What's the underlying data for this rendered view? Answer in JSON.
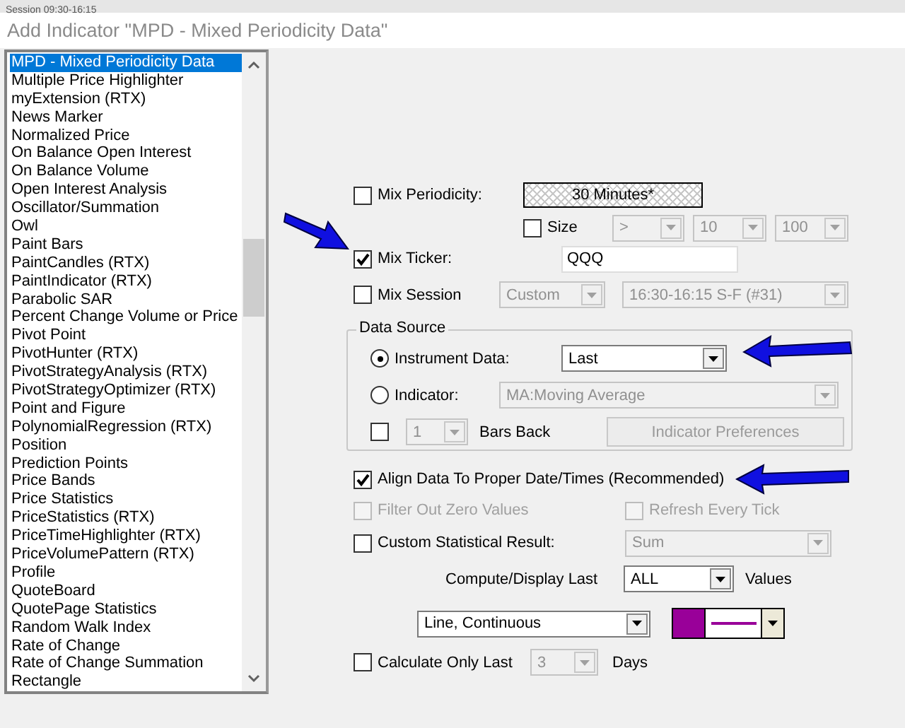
{
  "background_text": "Session 09:30-16:15",
  "window": {
    "title": "Add Indicator \"MPD - Mixed Periodicity Data\""
  },
  "indicator_list": [
    {
      "label": "MPD - Mixed Periodicity Data",
      "selected": true
    },
    {
      "label": "Multiple Price Highlighter",
      "selected": false
    },
    {
      "label": "myExtension (RTX)",
      "selected": false
    },
    {
      "label": "News Marker",
      "selected": false
    },
    {
      "label": "Normalized Price",
      "selected": false
    },
    {
      "label": "On Balance Open Interest",
      "selected": false
    },
    {
      "label": "On Balance Volume",
      "selected": false
    },
    {
      "label": "Open Interest Analysis",
      "selected": false
    },
    {
      "label": "Oscillator/Summation",
      "selected": false
    },
    {
      "label": "Owl",
      "selected": false
    },
    {
      "label": "Paint Bars",
      "selected": false
    },
    {
      "label": "PaintCandles (RTX)",
      "selected": false
    },
    {
      "label": "PaintIndicator (RTX)",
      "selected": false
    },
    {
      "label": "Parabolic SAR",
      "selected": false
    },
    {
      "label": "Percent Change Volume or Price",
      "selected": false
    },
    {
      "label": "Pivot Point",
      "selected": false
    },
    {
      "label": "PivotHunter (RTX)",
      "selected": false
    },
    {
      "label": "PivotStrategyAnalysis (RTX)",
      "selected": false
    },
    {
      "label": "PivotStrategyOptimizer (RTX)",
      "selected": false
    },
    {
      "label": "Point and Figure",
      "selected": false
    },
    {
      "label": "PolynomialRegression (RTX)",
      "selected": false
    },
    {
      "label": "Position",
      "selected": false
    },
    {
      "label": "Prediction Points",
      "selected": false
    },
    {
      "label": "Price Bands",
      "selected": false
    },
    {
      "label": "Price Statistics",
      "selected": false
    },
    {
      "label": "PriceStatistics (RTX)",
      "selected": false
    },
    {
      "label": "PriceTimeHighlighter (RTX)",
      "selected": false
    },
    {
      "label": "PriceVolumePattern (RTX)",
      "selected": false
    },
    {
      "label": "Profile",
      "selected": false
    },
    {
      "label": "QuoteBoard",
      "selected": false
    },
    {
      "label": "QuotePage Statistics",
      "selected": false
    },
    {
      "label": "Random Walk Index",
      "selected": false
    },
    {
      "label": "Rate of Change",
      "selected": false
    },
    {
      "label": "Rate of Change Summation",
      "selected": false
    },
    {
      "label": "Rectangle",
      "selected": false
    }
  ],
  "mix_periodicity": {
    "label": "Mix Periodicity:",
    "checked": false,
    "value": "30 Minutes*"
  },
  "size": {
    "label": "Size",
    "checked": false,
    "combos": [
      {
        "value": ">",
        "disabled": true
      },
      {
        "value": "10",
        "disabled": true
      },
      {
        "value": "100",
        "disabled": true
      }
    ]
  },
  "mix_ticker": {
    "label": "Mix Ticker:",
    "checked": true,
    "value": "QQQ"
  },
  "mix_session": {
    "label": "Mix Session",
    "checked": false,
    "combos": [
      {
        "value": "Custom",
        "disabled": true
      },
      {
        "value": "16:30-16:15 S-F (#31)",
        "disabled": true
      }
    ]
  },
  "data_source": {
    "title": "Data Source",
    "options": [
      {
        "label": "Instrument Data:",
        "selected": true,
        "combo": {
          "value": "Last",
          "disabled": false
        }
      },
      {
        "label": "Indicator:",
        "selected": false,
        "combo": {
          "value": "MA:Moving Average",
          "disabled": true
        }
      }
    ],
    "bars_back": {
      "checked": false,
      "combo": {
        "value": "1",
        "disabled": true
      },
      "label": "Bars Back"
    },
    "preferences_button": {
      "label": "Indicator Preferences",
      "disabled": true
    }
  },
  "align": {
    "label": "Align Data To Proper Date/Times (Recommended)",
    "checked": true
  },
  "filter_zero": {
    "label": "Filter Out Zero Values",
    "checked": false,
    "disabled": true
  },
  "refresh": {
    "label": "Refresh Every Tick",
    "checked": false,
    "disabled": true
  },
  "custom_result": {
    "label": "Custom Statistical Result:",
    "checked": false,
    "combo": {
      "value": "Sum",
      "disabled": true
    }
  },
  "compute": {
    "label": "Compute/Display Last",
    "combo": {
      "value": "ALL",
      "disabled": false
    },
    "suffix": "Values"
  },
  "plot_style": {
    "combo": {
      "value": "Line, Continuous",
      "disabled": false
    },
    "color": "#990099"
  },
  "calculate_only": {
    "label": "Calculate Only Last",
    "checked": false,
    "combo": {
      "value": "3",
      "disabled": true
    },
    "suffix": "Days"
  }
}
